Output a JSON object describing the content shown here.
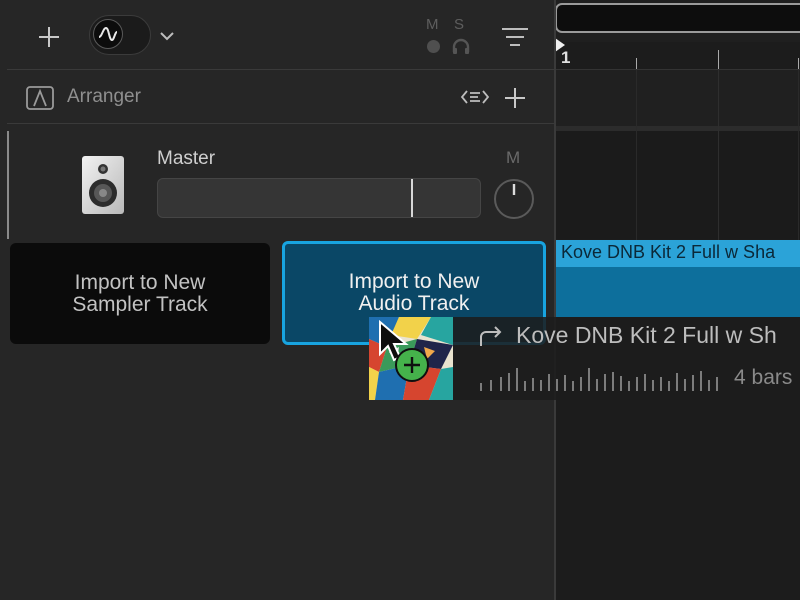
{
  "header": {
    "add_icon": "plus-icon",
    "instrument_icon": "waveform-icon",
    "dropdown_icon": "chevron-down-icon",
    "mute_label": "M",
    "solo_label": "S",
    "menu_icon": "filter-lines-icon"
  },
  "arranger": {
    "label": "Arranger",
    "icon": "arranger-a-icon",
    "expand_icon": "expand-arrows-icon",
    "add_icon": "plus-icon"
  },
  "master": {
    "label": "Master",
    "mute_label": "M",
    "speaker_icon": "speaker-icon",
    "fader_level": 0.79
  },
  "drop_targets": {
    "sampler_label": "Import to New Sampler Track",
    "audio_label": "Import to New Audio Track"
  },
  "timeline": {
    "bar_number": "1",
    "clip_title": "Kove DNB Kit 2 Full w Sha"
  },
  "drag_item": {
    "name": "Kove DNB Kit 2 Full w Sh",
    "duration": "4 bars",
    "replace_icon": "arrow-turn-icon",
    "add_badge_icon": "plus-circle-icon"
  },
  "colors": {
    "accent_blue": "#18a4e0",
    "clip_header": "#2ba3d8",
    "clip_body": "#0d6f9c",
    "add_green": "#45b24b"
  }
}
